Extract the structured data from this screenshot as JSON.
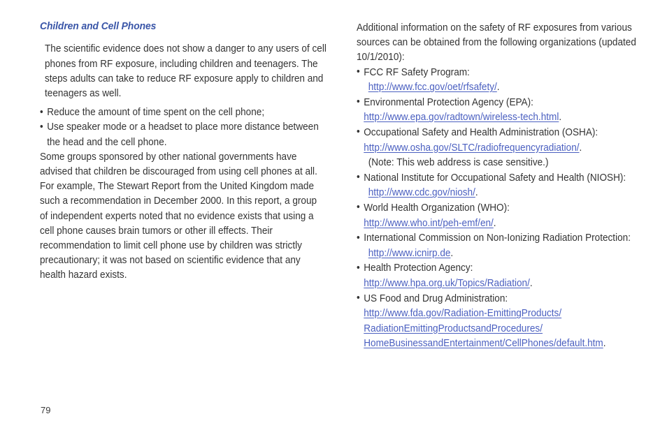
{
  "document": {
    "page_number": "79",
    "heading_color": "#3a56a8",
    "link_color": "#4a5fc0",
    "body_color": "#333333"
  },
  "left_column": {
    "section_title": "Children and Cell Phones",
    "paragraph_1": "The scientific evidence does not show a danger to any users of cell phones from RF exposure, including children and teenagers. The steps adults can take to reduce RF exposure apply to children and teenagers as well.",
    "bullets": [
      {
        "text": "Reduce the amount of time spent on the cell phone;"
      },
      {
        "text": "Use speaker mode or a headset to place more distance between the head and the cell phone."
      }
    ],
    "paragraph_2": "Some groups sponsored by other national governments have advised that children be discouraged from using cell phones at all. For example, The Stewart Report from the United Kingdom made such a recommendation in December 2000. In this report, a group of independent experts noted that no evidence exists that using a cell phone causes brain tumors or other ill effects. Their recommendation to limit cell phone use by children was strictly precautionary; it was not based on scientific evidence that any health hazard exists."
  },
  "right_column": {
    "intro": "Additional information on the safety of RF exposures from various sources can be obtained from the following organizations (updated 10/1/2010):",
    "organizations": [
      {
        "name": "FCC RF Safety Program:",
        "indented_url": true,
        "urls": [
          "http://www.fcc.gov/oet/rfsafety/"
        ],
        "trailing_period": ".",
        "note": ""
      },
      {
        "name": "Environmental Protection Agency (EPA):",
        "indented_url": false,
        "urls": [
          "http://www.epa.gov/radtown/wireless-tech.html"
        ],
        "trailing_period": ".",
        "note": ""
      },
      {
        "name": "Occupational Safety and Health Administration (OSHA):",
        "indented_url": false,
        "urls": [
          "http://www.osha.gov/SLTC/radiofrequencyradiation/"
        ],
        "trailing_period": ".",
        "note": "(Note: This web address is case sensitive.)"
      },
      {
        "name": "National Institute for Occupational Safety and Health (NIOSH):",
        "indented_url": true,
        "urls": [
          "http://www.cdc.gov/niosh/"
        ],
        "trailing_period": ".",
        "note": ""
      },
      {
        "name": "World Health Organization (WHO):",
        "indented_url": false,
        "urls": [
          "http://www.who.int/peh-emf/en/"
        ],
        "trailing_period": ".",
        "note": ""
      },
      {
        "name": "International Commission on Non-Ionizing Radiation Protection:",
        "indented_url": true,
        "urls": [
          "http://www.icnirp.de"
        ],
        "trailing_period": ".",
        "note": ""
      },
      {
        "name": "Health Protection Agency:",
        "indented_url": false,
        "urls": [
          "http://www.hpa.org.uk/Topics/Radiation/"
        ],
        "trailing_period": ".",
        "note": ""
      },
      {
        "name": "US Food and Drug Administration:",
        "indented_url": false,
        "urls": [
          "http://www.fda.gov/Radiation-EmittingProducts/",
          "RadiationEmittingProductsandProcedures/",
          "HomeBusinessandEntertainment/CellPhones/default.htm"
        ],
        "trailing_period": ".",
        "note": ""
      }
    ]
  }
}
